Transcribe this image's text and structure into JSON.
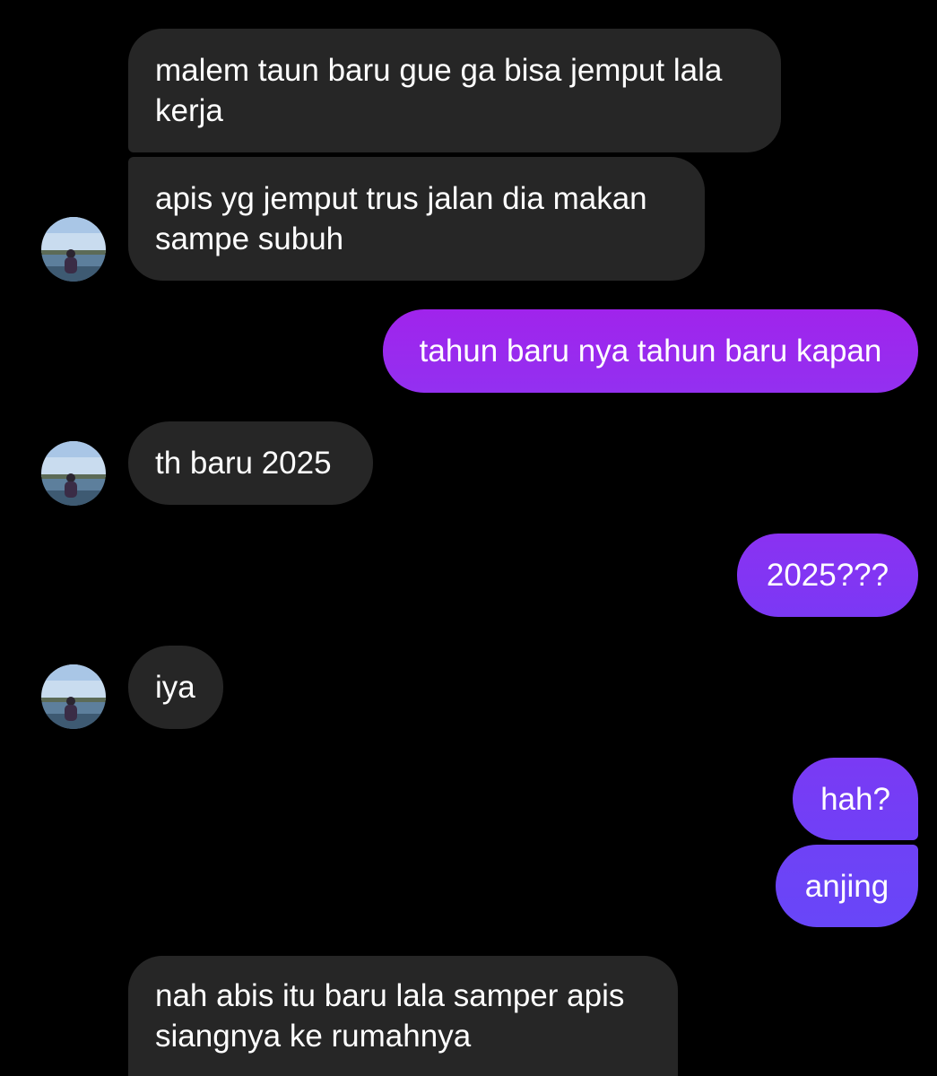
{
  "conversation": {
    "messages": [
      {
        "sender": "them",
        "lines": [
          "malem taun baru gue ga bisa jemput lala",
          "kerja"
        ]
      },
      {
        "sender": "them",
        "lines": [
          "apis yg jemput trus jalan dia makan",
          "sampe subuh"
        ]
      },
      {
        "sender": "me",
        "text": "tahun baru nya tahun baru kapan"
      },
      {
        "sender": "them",
        "text": "th baru 2025"
      },
      {
        "sender": "me",
        "text": "2025???"
      },
      {
        "sender": "them",
        "text": "iya"
      },
      {
        "sender": "me",
        "text": "hah?"
      },
      {
        "sender": "me",
        "text": "anjing"
      },
      {
        "sender": "them",
        "lines": [
          "nah abis itu baru lala samper apis",
          "siangnya ke rumahnya"
        ]
      }
    ]
  },
  "colors": {
    "background": "#000000",
    "incoming_bubble": "#262626",
    "outgoing_gradient_top": "#9b2ef0",
    "outgoing_gradient_bottom": "#6b3ef5",
    "text": "#ffffff"
  },
  "icons": {
    "avatar": "contact-avatar-photo"
  }
}
